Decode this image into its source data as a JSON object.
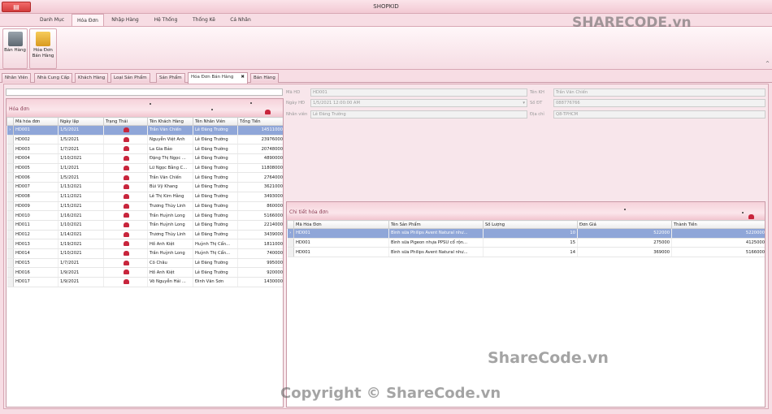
{
  "window": {
    "title": "SHOPKID"
  },
  "menu": [
    "Danh Mục",
    "Hóa Đơn",
    "Nhập Hàng",
    "Hệ Thống",
    "Thống Kê",
    "Cá Nhân"
  ],
  "ribbon": {
    "btn1": "Bán Hàng",
    "btn2a": "Hóa Đơn",
    "btn2b": "Bán Hàng"
  },
  "tabs": [
    "Nhân Viên",
    "Nhà Cung Cấp",
    "Khách Hàng",
    "Loại Sản Phẩm",
    "Sản Phẩm",
    "Hóa Đơn Bán Hàng",
    "Bán Hàng"
  ],
  "left": {
    "title": "Hóa đơn",
    "cols": [
      "Mã hóa đơn",
      "Ngày lập",
      "Trạng Thái",
      "Tên Khách Hàng",
      "Tên Nhân Viên",
      "Tổng Tiền"
    ],
    "rows": [
      [
        "HD001",
        "1/5/2021",
        "Trần Văn Chiến",
        "Lê Đăng Trường",
        "14511000"
      ],
      [
        "HD002",
        "1/5/2021",
        "Nguyễn Việt Anh",
        "Lê Đăng Trường",
        "23976000"
      ],
      [
        "HD003",
        "1/7/2021",
        "La Gia Bảo",
        "Lê Đăng Trường",
        "20748000"
      ],
      [
        "HD004",
        "1/10/2021",
        "Đặng Thị Ngọc ...",
        "Lê Đăng Trường",
        "4890000"
      ],
      [
        "HD005",
        "1/1/2021",
        "Lữ Ngọc Bằng C...",
        "Lê Đăng Trường",
        "11808000"
      ],
      [
        "HD006",
        "1/5/2021",
        "Trần Văn Chiến",
        "Lê Đăng Trường",
        "2764000"
      ],
      [
        "HD007",
        "1/13/2021",
        "Bùi Vỹ Khang",
        "Lê Đăng Trường",
        "3621000"
      ],
      [
        "HD008",
        "1/11/2021",
        "Lê Thị Kim Hằng",
        "Lê Đăng Trường",
        "3493000"
      ],
      [
        "HD009",
        "1/15/2021",
        "Trương Thùy Linh",
        "Lê Đăng Trường",
        "860000"
      ],
      [
        "HD010",
        "1/16/2021",
        "Trần Huỳnh Long",
        "Lê Đăng Trường",
        "5166000"
      ],
      [
        "HD011",
        "1/10/2021",
        "Trần Huỳnh Long",
        "Lê Đăng Trường",
        "2214000"
      ],
      [
        "HD012",
        "1/14/2021",
        "Trương Thùy Linh",
        "Lê Đăng Trường",
        "3439000"
      ],
      [
        "HD013",
        "1/19/2021",
        "Hồ Anh Kiệt",
        "Huỳnh Thị Cẩn...",
        "1811000"
      ],
      [
        "HD014",
        "1/10/2021",
        "Trần Huỳnh Long",
        "Huỳnh Thị Cẩn...",
        "740000"
      ],
      [
        "HD015",
        "1/7/2021",
        "Cô Châu",
        "Lê Đăng Trường",
        "995000"
      ],
      [
        "HD016",
        "1/9/2021",
        "Hồ Anh Kiệt",
        "Lê Đăng Trường",
        "920000"
      ],
      [
        "HD017",
        "1/9/2021",
        "Võ Nguyễn Hải ...",
        "Đinh Văn Sơn",
        "1430000"
      ]
    ]
  },
  "form": {
    "mahd_label": "Mã HD",
    "mahd": "HD001",
    "ngay_label": "Ngày HĐ",
    "ngay": "1/5/2021 12:00:00 AM",
    "nv_label": "Nhân viên",
    "nv": "Lê Đăng Trường",
    "tenkh_label": "Tên KH",
    "tenkh": "Trần Văn Chiến",
    "sdt_label": "Số ĐT",
    "sdt": "088776766",
    "diachi_label": "Địa chỉ",
    "diachi": "Q8-TPHCM"
  },
  "right": {
    "title": "Chi tiết hóa đơn",
    "cols": [
      "Mã Hóa Đơn",
      "Tên Sản Phẩm",
      "Số Lượng",
      "Đơn Giá",
      "Thành Tiền"
    ],
    "rows": [
      [
        "HD001",
        "Bình sữa Philips Avent Natural như...",
        "10",
        "522000",
        "5220000"
      ],
      [
        "HD001",
        "Bình sữa Pigeon nhựa PPSU cổ rộn...",
        "15",
        "275000",
        "4125000"
      ],
      [
        "HD001",
        "Bình sữa Philips Avent Natural như...",
        "14",
        "369000",
        "5166000"
      ]
    ]
  },
  "watermark": {
    "top": "ShareCode.vn",
    "mid": "ShareCode.vn",
    "bottom": "Copyright © ShareCode.vn",
    "logo_a": "SHARE",
    "logo_b": "CODE.vn"
  },
  "colors": {
    "accent": "#c8253c",
    "selection": "#8fa6d8",
    "brand": "#f7dde4"
  }
}
